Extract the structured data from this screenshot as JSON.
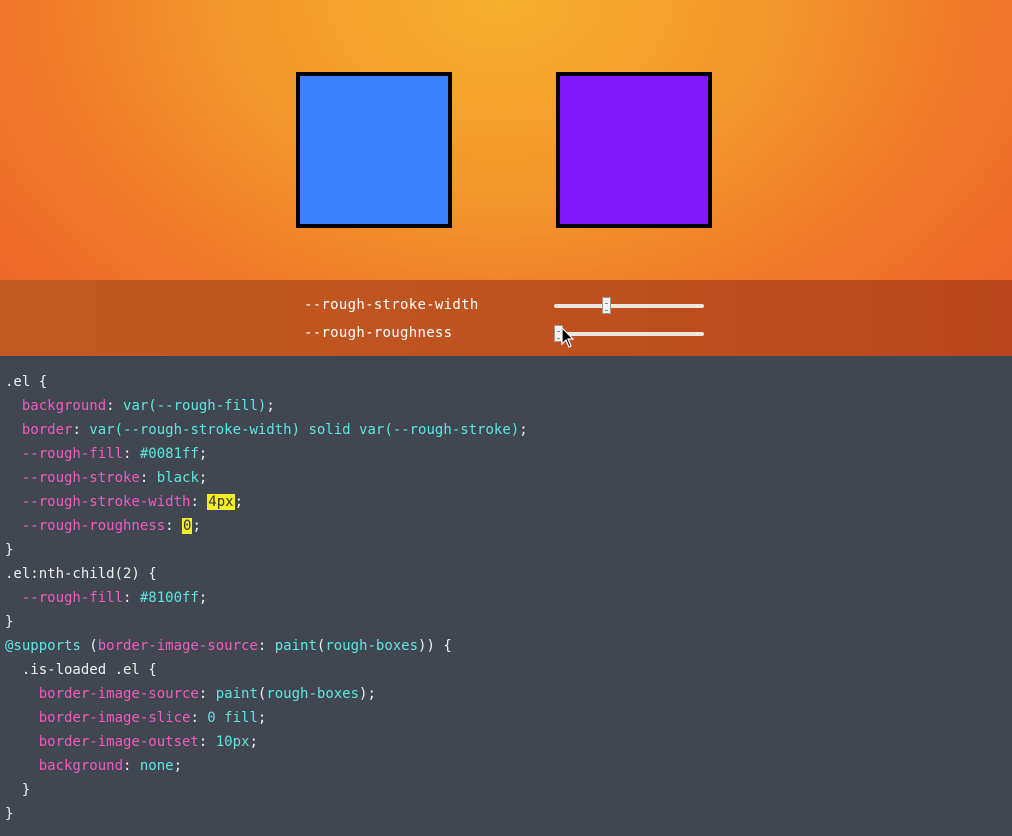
{
  "boxes": [
    {
      "name": "box-blue",
      "fill": "#3a81fb"
    },
    {
      "name": "box-purple",
      "fill": "#8117fb"
    }
  ],
  "controls": {
    "stroke_width": {
      "label": "--rough-stroke-width",
      "value_fraction": 0.34
    },
    "roughness": {
      "label": "--rough-roughness",
      "value_fraction": 0.0
    }
  },
  "colors": {
    "property": "#f25ac0",
    "value": "#5ee6e4",
    "highlight": "#f2ef28",
    "code_bg": "#404750"
  },
  "code": {
    "l1_sel": ".el {",
    "l2_prop": "background",
    "l2_val": "var(--rough-fill)",
    "l3_prop": "border",
    "l3_val1": "var(--rough-stroke-width)",
    "l3_val2": "solid",
    "l3_val3": "var(--rough-stroke)",
    "l4_prop": "--rough-fill",
    "l4_val": "#0081ff",
    "l5_prop": "--rough-stroke",
    "l5_val": "black",
    "l6_prop": "--rough-stroke-width",
    "l6_val": "4px",
    "l7_prop": "--rough-roughness",
    "l7_val": "0",
    "l8": "}",
    "l9_sel": ".el:nth-child(2) {",
    "l10_prop": "--rough-fill",
    "l10_val": "#8100ff",
    "l11": "}",
    "l12_at": "@supports",
    "l12_prop": "border-image-source",
    "l12_val": "paint",
    "l12_arg": "rough-boxes",
    "l13_sel": "  .is-loaded .el {",
    "l14_prop": "border-image-source",
    "l14_val": "paint",
    "l14_arg": "rough-boxes",
    "l15_prop": "border-image-slice",
    "l15_val": "0 fill",
    "l16_prop": "border-image-outset",
    "l16_val": "10px",
    "l17_prop": "background",
    "l17_val": "none",
    "l18": "  }",
    "l19": "}"
  }
}
